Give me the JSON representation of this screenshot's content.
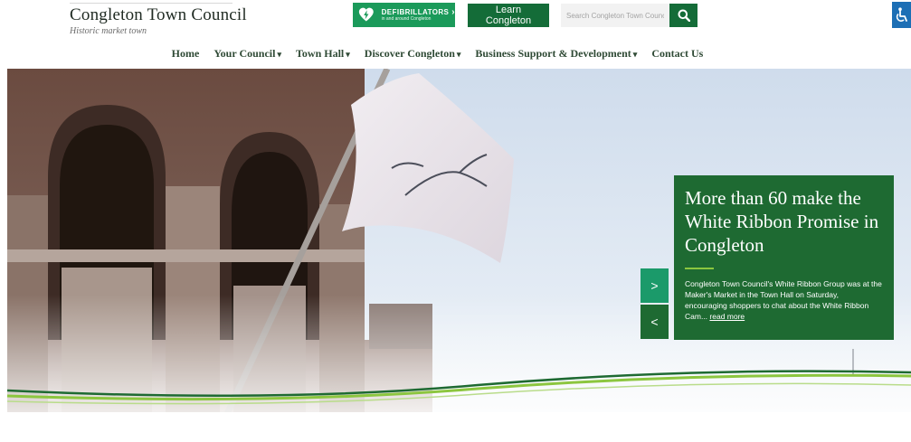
{
  "header": {
    "title": "Congleton Town Council",
    "tagline": "Historic market town",
    "defib_label": "DEFIBRILLATORS",
    "defib_sub": "in and around Congleton",
    "learn_label": "Learn Congleton",
    "search_placeholder": "Search Congleton Town Council"
  },
  "nav": {
    "items": [
      "Home",
      "Your Council",
      "Town Hall",
      "Discover Congleton",
      "Business Support & Development",
      "Contact Us"
    ]
  },
  "slide": {
    "title": "More than 60 make the White Ribbon Promise in Congleton",
    "text": "Congleton Town Council's White Ribbon Group was at the Maker's Market in the Town Hall on Saturday, encouraging shoppers to chat about the White Ribbon Cam...",
    "read_more": "read more",
    "next_label": ">",
    "prev_label": "<"
  },
  "colors": {
    "brand_green": "#146c38",
    "defib_green": "#1b9a5a",
    "card_green": "#1e6a32",
    "accent_lime": "#8cc63f",
    "access_blue": "#1d6fb5"
  }
}
